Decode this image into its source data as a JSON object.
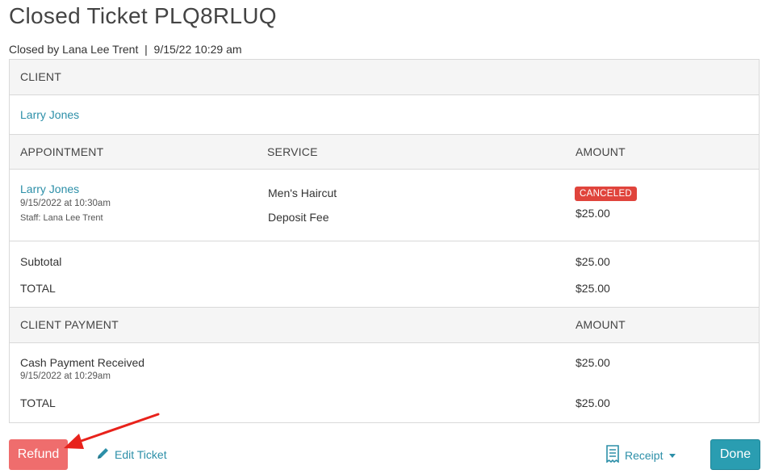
{
  "page": {
    "title": "Closed Ticket PLQ8RLUQ",
    "closed_by": "Closed by Lana Lee Trent",
    "separator": "|",
    "closed_at": "9/15/22 10:29 am"
  },
  "client_section": {
    "header": "CLIENT",
    "client_name": "Larry Jones"
  },
  "appointment_section": {
    "headers": {
      "appointment": "APPOINTMENT",
      "service": "SERVICE",
      "amount": "AMOUNT"
    },
    "client_name": "Larry Jones",
    "datetime": "9/15/2022 at 10:30am",
    "staff": "Staff: Lana Lee Trent",
    "services": [
      "Men's Haircut",
      "Deposit Fee"
    ],
    "status_badge": "CANCELED",
    "amount": "$25.00"
  },
  "totals": {
    "subtotal_label": "Subtotal",
    "subtotal_value": "$25.00",
    "total_label": "TOTAL",
    "total_value": "$25.00"
  },
  "payment_section": {
    "headers": {
      "client_payment": "CLIENT PAYMENT",
      "amount": "AMOUNT"
    },
    "method": "Cash Payment Received",
    "datetime": "9/15/2022 at 10:29am",
    "amount": "$25.00",
    "total_label": "TOTAL",
    "total_value": "$25.00"
  },
  "actions": {
    "refund": "Refund",
    "edit_ticket": "Edit Ticket",
    "receipt": "Receipt",
    "done": "Done"
  },
  "colors": {
    "link": "#2c8fa8",
    "refund": "#ef6d6d",
    "done": "#2a9db1",
    "canceled_badge": "#e0443c",
    "annotation_arrow": "#e8221b"
  },
  "icons": [
    "pencil-icon",
    "receipt-icon",
    "caret-down-icon",
    "annotation-arrow"
  ]
}
